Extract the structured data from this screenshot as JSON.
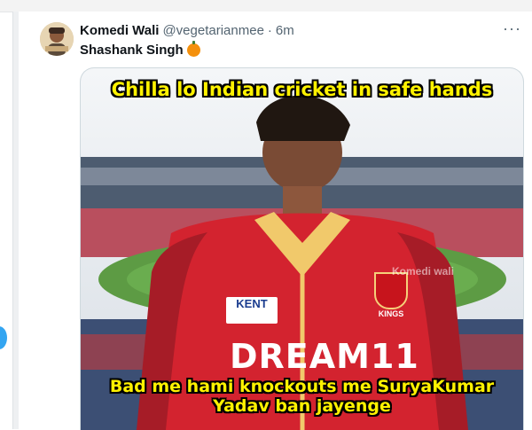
{
  "tweet": {
    "author_name": "Komedi Wali",
    "handle": "@vegetarianmee",
    "separator": "·",
    "time": "6m",
    "more_label": "···",
    "text": "Shashank Singh",
    "emoji_icon": "pumpkin-icon"
  },
  "meme": {
    "top_caption": "Chilla lo Indian cricket in safe hands",
    "bottom_caption_line1": "Bad me hami knockouts me SuryaKumar",
    "bottom_caption_line2": "Yadav ban jayenge",
    "jersey_sponsor": "DREAM11",
    "kent_logo": "KENT",
    "kings_logo": "KINGS",
    "watermark": "Komedi wali"
  },
  "colors": {
    "caption_yellow": "#fff200",
    "jersey_red": "#d3232f",
    "accent_blue": "#1d9bf0"
  }
}
